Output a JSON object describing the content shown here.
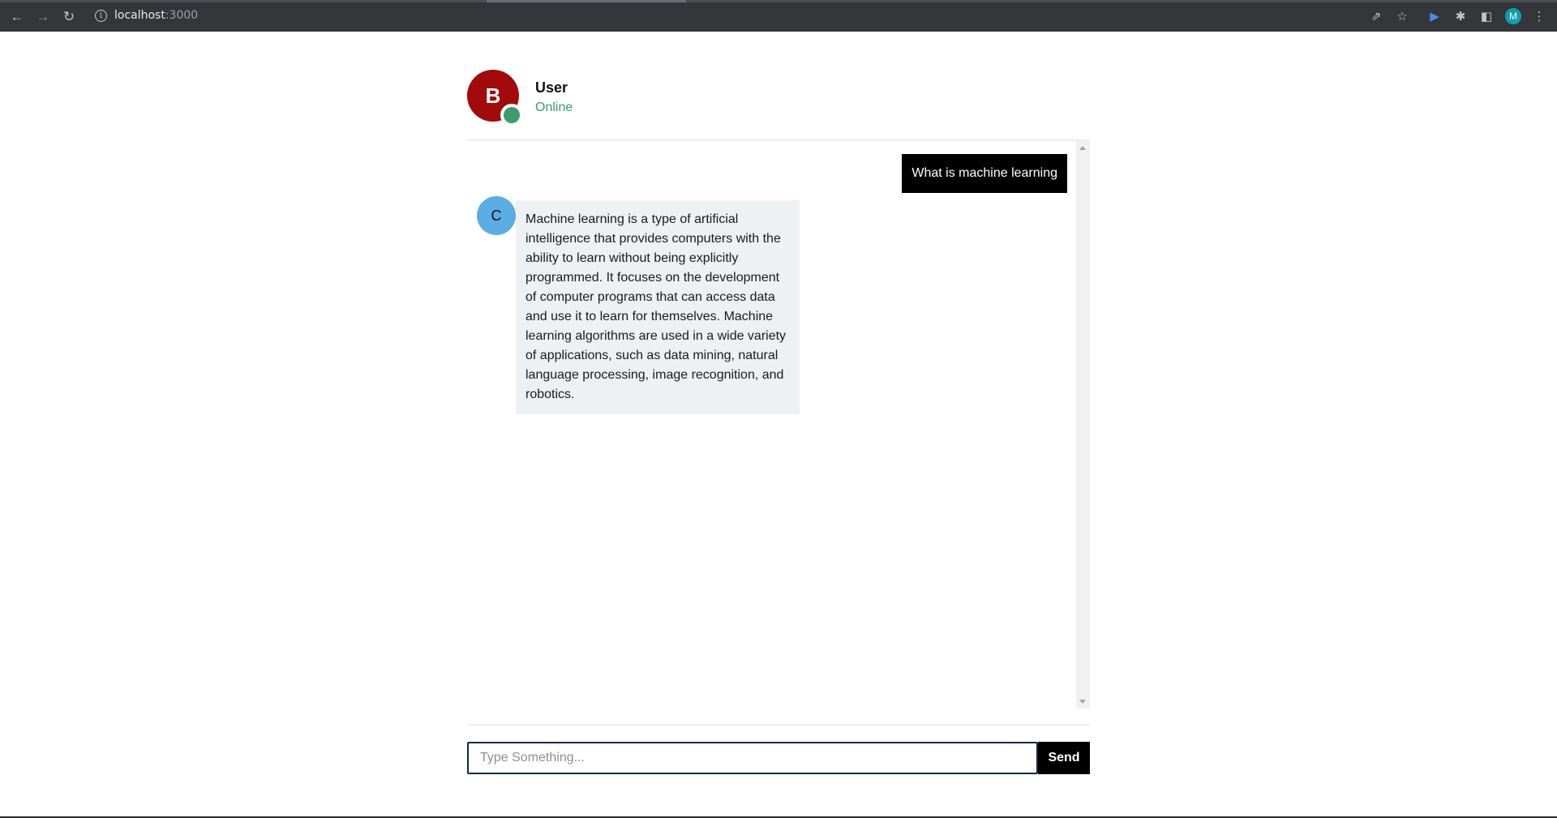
{
  "browser": {
    "url_host": "localhost",
    "url_port": ":3000",
    "nav_icons": [
      "back-arrow-icon",
      "forward-arrow-icon",
      "reload-icon",
      "info-icon"
    ],
    "toolbar_icons": [
      "share-icon",
      "star-icon",
      "extension-cursor-icon",
      "puzzle-icon",
      "side-panel-icon",
      "kebab-menu-icon"
    ],
    "profile_initial": "M",
    "colors": {
      "frame": "#35363a",
      "profile": "#0fa0ad"
    }
  },
  "chat_header": {
    "avatar_initial": "B",
    "name": "User",
    "status": "Online",
    "colors": {
      "avatar": "#a30a0a",
      "status": "#3a9d6d"
    }
  },
  "messages": [
    {
      "role": "user",
      "text": "What is machine learning"
    },
    {
      "role": "bot",
      "avatar_initial": "C",
      "text": "Machine learning is a type of artificial intelligence that provides computers with the ability to learn without being explicitly programmed. It focuses on the development of computer programs that can access data and use it to learn for themselves. Machine learning algorithms are used in a wide variety of applications, such as data mining, natural language processing, image recognition, and robotics."
    }
  ],
  "composer": {
    "placeholder": "Type Something...",
    "value": "",
    "send_label": "Send"
  },
  "colors": {
    "bot_avatar": "#5aade5",
    "bot_bubble": "#eef1f4",
    "user_bubble": "#000000"
  }
}
